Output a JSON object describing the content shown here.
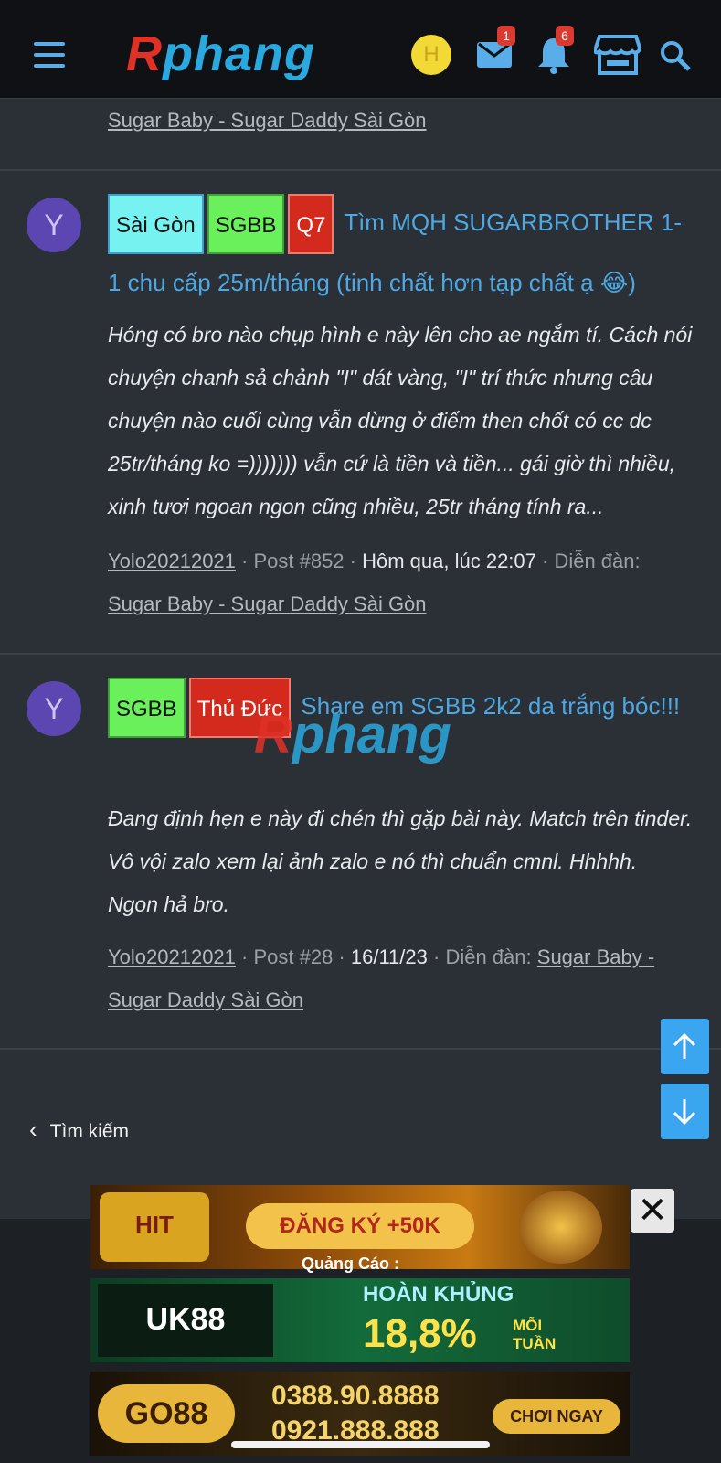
{
  "header": {
    "logo_text": "Rphang",
    "user_initial": "H",
    "messages_count": "1",
    "alerts_count": "6"
  },
  "post0": {
    "forum_link": "Sugar Baby - Sugar Daddy Sài Gòn"
  },
  "post1": {
    "avatar_initial": "Y",
    "tags": [
      "Sài Gòn",
      "SGBB",
      "Q7"
    ],
    "title": "Tìm MQH SUGARBROTHER 1-1 chu cấp 25m/tháng (tinh chất hơn tạp chất ạ 😂)",
    "snippet": "Hóng có bro nào chụp hình e này lên cho ae ngắm tí. Cách nói chuyện chanh sả chảnh \"I\" dát vàng, \"I\" trí thức nhưng câu chuyện nào cuối cùng vẫn dừng ở điểm then chốt có cc dc 25tr/tháng ko =))))))) vẫn cứ là tiền và tiền... gái giờ thì nhiều, xinh tươi ngoan ngon cũng nhiều, 25tr tháng tính ra...",
    "author": "Yolo20212021",
    "post_no": "Post #852",
    "date": "Hôm qua, lúc 22:07",
    "forum_label": "Diễn đàn:",
    "forum_link": "Sugar Baby - Sugar Daddy Sài Gòn"
  },
  "post2": {
    "avatar_initial": "Y",
    "tags": [
      "SGBB",
      "Thủ Đức"
    ],
    "title": "Share em SGBB 2k2 da trắng bóc!!!",
    "snippet": "Đang định hẹn e này đi chén thì gặp bài này. Match trên tinder. Vô vội zalo xem lại ảnh zalo e nó thì chuẩn cmnl. Hhhhh. Ngon hả bro.",
    "author": "Yolo20212021",
    "post_no": "Post #28",
    "date": "16/11/23",
    "forum_label": "Diễn đàn:",
    "forum_link": "Sugar Baby - Sugar Daddy Sài Gòn"
  },
  "nav": {
    "back_label": "Tìm kiếm"
  },
  "ads": {
    "ad1_brand": "HIT CLUB",
    "ad1_text": "ĐĂNG KÝ +50K",
    "ad_label": "Quảng Cáo :",
    "ad2_brand": "UK88 sports",
    "ad2_text1": "HOÀN KHỦNG",
    "ad2_text2": "18,8%",
    "ad2_text3": "MỖI TUẦN",
    "ad3_brand": "GO88",
    "ad3_phone1": "0388.90.8888",
    "ad3_phone2": "0921.888.888",
    "ad3_cta": "CHƠI NGAY"
  },
  "watermark": "Rphang",
  "colors": {
    "accent": "#4ea8e2",
    "background": "#2b2f36",
    "topbar": "#0f1114",
    "badge": "#d93b30"
  }
}
